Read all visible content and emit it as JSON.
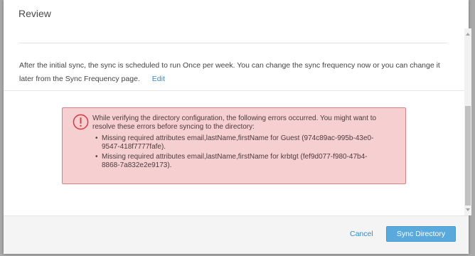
{
  "dialog": {
    "title": "Review",
    "sync_message": "After the initial sync, the sync is scheduled to run Once per week. You can change the sync frequency now or you can change it later from the Sync Frequency page.",
    "edit_label": "Edit"
  },
  "error": {
    "message": "While verifying the directory configuration, the following errors occurred. You might want to resolve these errors before syncing to the directory:",
    "items": [
      "Missing required attributes email,lastName,firstName for Guest (974c89ac-995b-43e0-9547-418f7777fafe).",
      "Missing required attributes email,lastName,firstName for krbtgt (fef9d077-f980-47b4-8868-7a832e2e9173)."
    ],
    "icon": "exclamation-circle-icon",
    "background_color": "#f6cfd1",
    "border_color": "#e07d82"
  },
  "footer": {
    "cancel_label": "Cancel",
    "sync_label": "Sync Directory"
  },
  "colors": {
    "accent": "#2f8bd0",
    "primary_button": "#5aa9dc"
  }
}
